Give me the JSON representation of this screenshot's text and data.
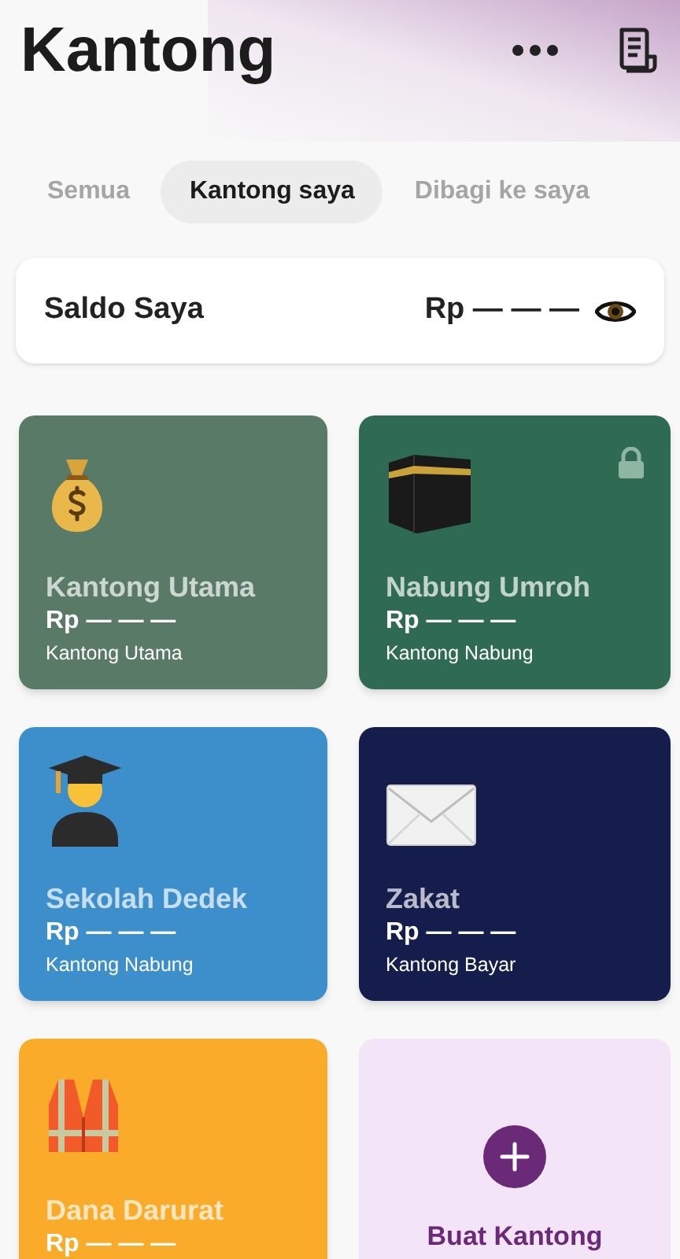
{
  "header": {
    "title": "Kantong"
  },
  "tabs": [
    {
      "label": "Semua",
      "selected": false
    },
    {
      "label": "Kantong saya",
      "selected": true
    },
    {
      "label": "Dibagi ke saya",
      "selected": false
    }
  ],
  "balance": {
    "label": "Saldo Saya",
    "amount": "Rp — — —"
  },
  "pockets": [
    {
      "kind": "pocket",
      "name": "Kantong Utama",
      "amount": "Rp — — —",
      "type": "Kantong Utama",
      "color": "#587a66",
      "locked": false
    },
    {
      "kind": "pocket",
      "name": "Nabung Umroh",
      "amount": "Rp — — —",
      "type": "Kantong Nabung",
      "color": "#2f6b52",
      "locked": true
    },
    {
      "kind": "pocket",
      "name": "Sekolah Dedek",
      "amount": "Rp — — —",
      "type": "Kantong Nabung",
      "color": "#3d8fcb",
      "locked": false
    },
    {
      "kind": "pocket",
      "name": "Zakat",
      "amount": "Rp — — —",
      "type": "Kantong Bayar",
      "color": "#141d4b",
      "locked": false
    },
    {
      "kind": "pocket",
      "name": "Dana Darurat",
      "amount": "Rp — — —",
      "color": "#fbab2a",
      "locked": false
    },
    {
      "kind": "create",
      "label": "Buat Kantong"
    }
  ]
}
